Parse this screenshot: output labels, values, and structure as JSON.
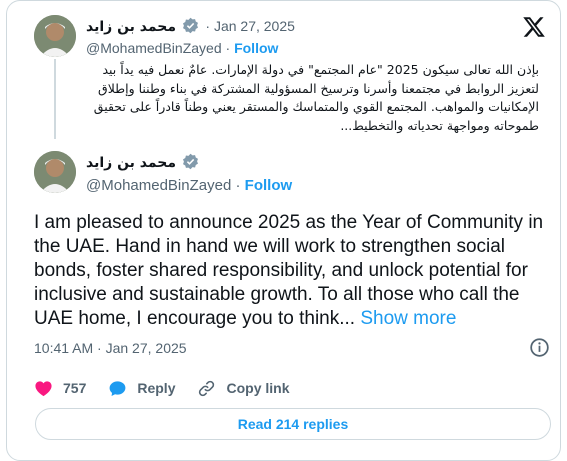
{
  "quoted_post": {
    "author_name": "محمد بن زايد",
    "date": "· Jan 27, 2025",
    "handle": "@MohamedBinZayed",
    "separator": " · ",
    "follow_label": "Follow",
    "text": "بإذن الله تعالى سيكون 2025 \"عام المجتمع\" في دولة الإمارات. عامٌ نعمل فيه يداً بيد لتعزيز الروابط في مجتمعنا وأسرنا وترسيخ المسؤولية المشتركة في بناء وطننا وإطلاق الإمكانيات والمواهب. المجتمع القوي والمتماسك والمستقر يعني وطناً قادراً على تحقيق طموحاته ومواجهة تحدياته والتخطيط..."
  },
  "main_post": {
    "author_name": "محمد بن زايد",
    "handle": "@MohamedBinZayed",
    "separator": " · ",
    "follow_label": "Follow",
    "text": "I am pleased to announce 2025 as the Year of Community in the UAE. Hand in hand we will work to strengthen social bonds, foster shared responsibility, and unlock potential for inclusive and sustainable growth. To all those who call the UAE home, I encourage you to think...",
    "show_more_label": "Show more",
    "timestamp": "10:41 AM · Jan 27, 2025"
  },
  "actions": {
    "like_count": "757",
    "reply_label": "Reply",
    "copy_link_label": "Copy link"
  },
  "read_replies_label": "Read 214 replies",
  "colors": {
    "accent": "#1d9bf0",
    "like": "#f91880",
    "verified": "#829aab",
    "text": "#0f1419",
    "muted": "#536471",
    "border": "#cfd9de"
  },
  "icons": [
    "x-logo-icon",
    "verified-badge-icon",
    "info-icon",
    "heart-icon",
    "reply-bubble-icon",
    "link-icon"
  ]
}
